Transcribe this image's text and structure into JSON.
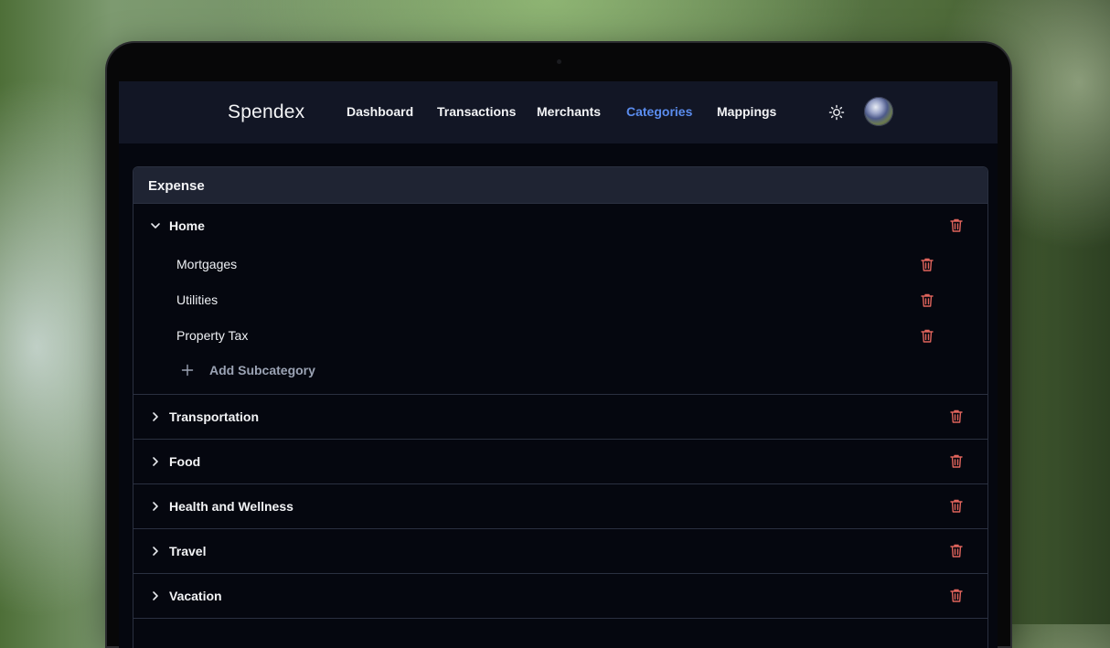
{
  "app": {
    "brand": "Spendex"
  },
  "nav": {
    "items": [
      {
        "label": "Dashboard",
        "active": false
      },
      {
        "label": "Transactions",
        "active": false
      },
      {
        "label": "Merchants",
        "active": false
      },
      {
        "label": "Categories",
        "active": true
      },
      {
        "label": "Mappings",
        "active": false
      }
    ],
    "theme_icon": "sun-icon",
    "avatar_icon": "user-avatar"
  },
  "card": {
    "title": "Expense",
    "categories": [
      {
        "label": "Home",
        "expanded": true,
        "subcategories": [
          {
            "label": "Mortgages"
          },
          {
            "label": "Utilities"
          },
          {
            "label": "Property Tax"
          }
        ],
        "add_label": "Add Subcategory"
      },
      {
        "label": "Transportation",
        "expanded": false
      },
      {
        "label": "Food",
        "expanded": false
      },
      {
        "label": "Health and Wellness",
        "expanded": false
      },
      {
        "label": "Travel",
        "expanded": false
      },
      {
        "label": "Vacation",
        "expanded": false
      }
    ]
  },
  "colors": {
    "accent": "#5b8def",
    "danger": "#e0645c",
    "navbar_bg": "#121625",
    "page_bg": "#05070f"
  },
  "icons": {
    "delete": "trash-icon",
    "expand": "chevron-right-icon",
    "collapse": "chevron-down-icon",
    "add": "plus-icon"
  }
}
